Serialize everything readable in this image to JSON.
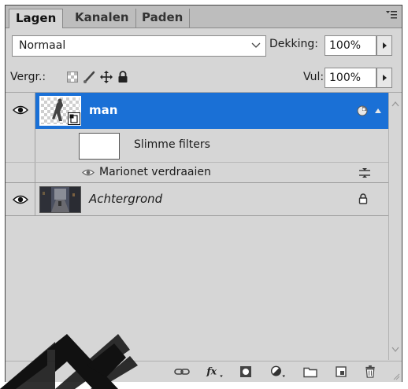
{
  "tabs": [
    {
      "label": "Lagen",
      "active": true
    },
    {
      "label": "Kanalen",
      "active": false
    },
    {
      "label": "Paden",
      "active": false
    }
  ],
  "blend_mode": {
    "value": "Normaal"
  },
  "opacity": {
    "label": "Dekking:",
    "value": "100%"
  },
  "lock": {
    "label": "Vergr.:"
  },
  "fill": {
    "label": "Vul:",
    "value": "100%"
  },
  "layers": {
    "man": {
      "name": "man",
      "selected": true
    },
    "smart_filters": {
      "label": "Slimme filters"
    },
    "puppet_warp": {
      "label": "Marionet verdraaien"
    },
    "background": {
      "name": "Achtergrond",
      "locked": true
    }
  },
  "watermark": {
    "letter": "M"
  },
  "colors": {
    "selection": "#1a70d6",
    "panel": "#d6d6d6",
    "tabbar": "#bdbdbd"
  },
  "footer_icons": [
    "link-icon",
    "fx-icon",
    "mask-icon",
    "adjustment-icon",
    "group-icon",
    "new-layer-icon",
    "trash-icon"
  ]
}
